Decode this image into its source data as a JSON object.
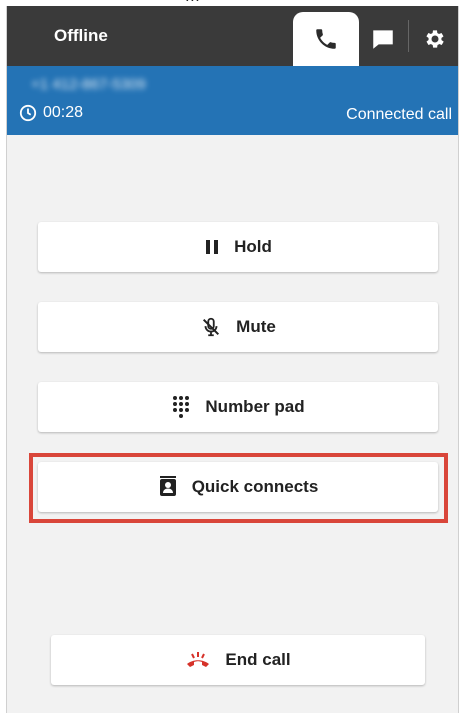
{
  "header": {
    "status": "Offline",
    "tabs": [
      {
        "name": "phone",
        "icon": "phone-icon",
        "active": true
      },
      {
        "name": "chat",
        "icon": "chat-icon",
        "active": false
      },
      {
        "name": "settings",
        "icon": "gear-icon",
        "active": false
      }
    ]
  },
  "call": {
    "number": "+1 412-867-5309",
    "timer": "00:28",
    "state": "Connected call"
  },
  "actions": {
    "hold": "Hold",
    "mute": "Mute",
    "number_pad": "Number pad",
    "quick_connects": "Quick connects",
    "end_call": "End call"
  },
  "colors": {
    "topbar": "#3a3a3a",
    "callbar": "#2473b5",
    "highlight": "#d9463a",
    "end_icon": "#d6322a"
  }
}
